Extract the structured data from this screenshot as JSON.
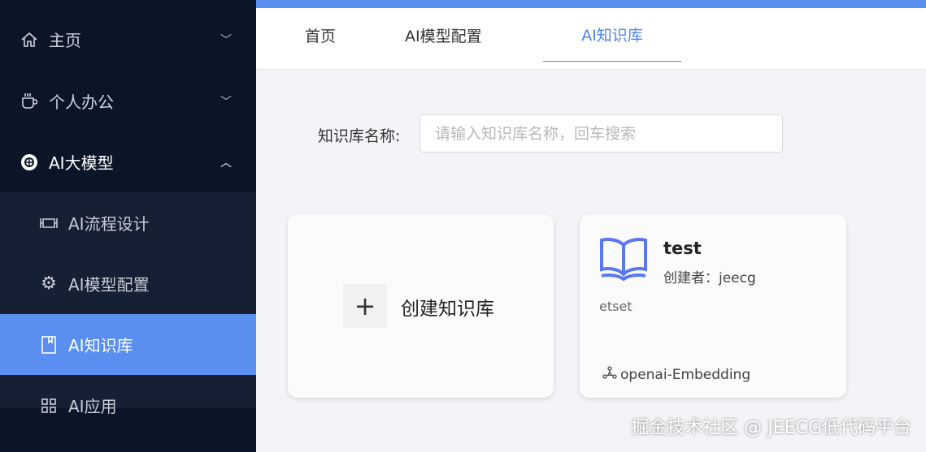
{
  "sidebar": {
    "menus": [
      {
        "label": "主页",
        "icon": "home-icon",
        "expanded": false
      },
      {
        "label": "个人办公",
        "icon": "coffee-icon",
        "expanded": false
      },
      {
        "label": "AI大模型",
        "icon": "ai-model-icon",
        "expanded": true
      }
    ],
    "submenu": [
      {
        "label": "AI流程设计",
        "icon": "flow-icon"
      },
      {
        "label": "AI模型配置",
        "icon": "gear-icon"
      },
      {
        "label": "AI知识库",
        "icon": "book-icon",
        "active": true
      },
      {
        "label": "AI应用",
        "icon": "grid-icon"
      }
    ]
  },
  "tabs": [
    {
      "label": "首页"
    },
    {
      "label": "AI模型配置"
    },
    {
      "label": "AI知识库",
      "active": true
    }
  ],
  "search": {
    "label": "知识库名称:",
    "placeholder": "请输入知识库名称，回车搜索",
    "value": ""
  },
  "create_card": {
    "label": "创建知识库"
  },
  "knowledge_cards": [
    {
      "title": "test",
      "creator": "创建者：jeecg",
      "description": "etset",
      "model": "openai-Embedding"
    }
  ],
  "watermark": "掘金技术社区 @ JEECG低代码平台",
  "colors": {
    "accent": "#5a8ef0",
    "sidebar": "#0b1528"
  }
}
